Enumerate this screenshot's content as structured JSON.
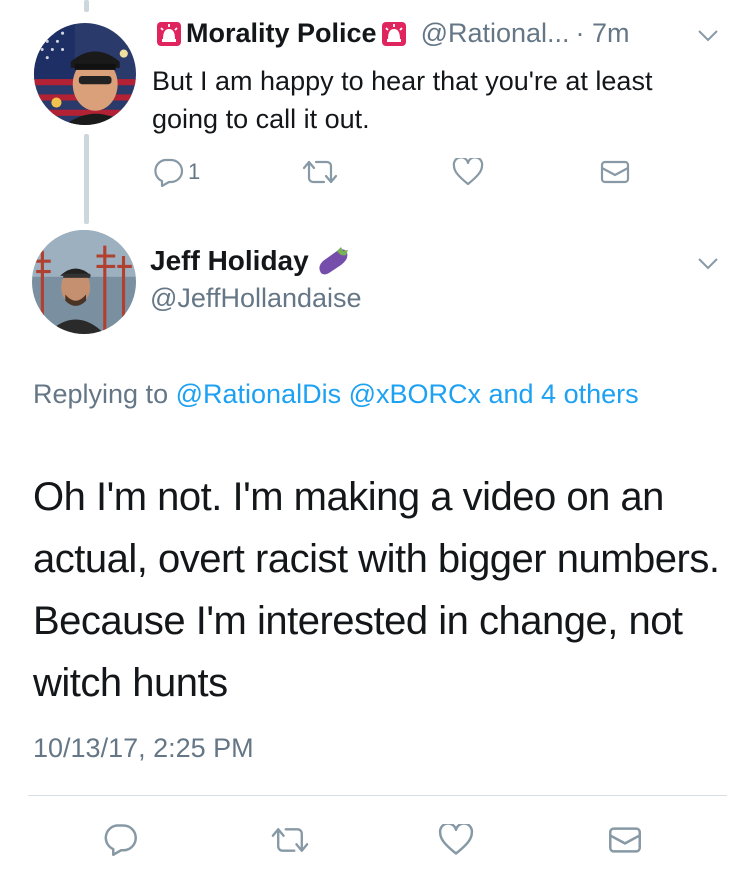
{
  "tweet1": {
    "display_name": "Morality Police",
    "handle": "@Rational...",
    "time": "· 7m",
    "text": "But I am happy to hear that you're at least going to call it out.",
    "reply_count": "1"
  },
  "tweet2": {
    "display_name": "Jeff Holiday",
    "handle": "@JeffHollandaise",
    "replying_prefix": "Replying to",
    "replying_mentions": "@RationalDis @xBORCx and 4 others",
    "text": "Oh I'm not. I'm making a video on an actual, overt racist with bigger numbers. Because I'm interested in change, not witch hunts",
    "timestamp": "10/13/17, 2:25 PM"
  },
  "colors": {
    "link": "#1da1f2",
    "muted": "#657786",
    "thread_line": "#cdd6dd",
    "icon_gray": "#8899a6"
  },
  "icons": [
    "siren-emoji",
    "eggplant-emoji",
    "reply-icon",
    "retweet-icon",
    "like-icon",
    "dm-icon",
    "chevron-down-icon"
  ]
}
